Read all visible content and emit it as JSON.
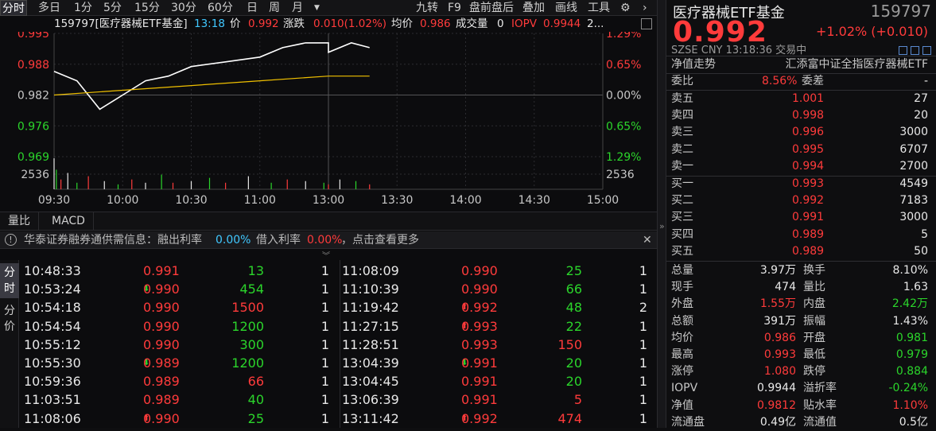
{
  "toolbar": {
    "left_items": [
      "分时",
      "多日",
      "1分",
      "5分",
      "15分",
      "30分",
      "60分",
      "日",
      "周",
      "月"
    ],
    "dropdown_glyph": "▼",
    "right_items": [
      "九转",
      "F9",
      "盘前盘后",
      "叠加",
      "画线",
      "工具"
    ]
  },
  "info": {
    "code_name": "159797[医疗器械ETF基金]",
    "time": "13:18",
    "price_label": "价",
    "price": "0.992",
    "change_label": "涨跌",
    "change": "0.010(1.02%)",
    "avg_label": "均价",
    "avg": "0.986",
    "volume_label": "成交量",
    "volume": "0",
    "iopv_label": "IOPV",
    "iopv": "0.9944",
    "more": "2..."
  },
  "chart": {
    "left_axis": [
      "0.995",
      "0.988",
      "0.982",
      "0.976",
      "0.969"
    ],
    "right_axis": [
      "1.29%",
      "0.65%",
      "0.00%",
      "0.65%",
      "1.29%"
    ],
    "vol_label_left": "2536",
    "vol_label_right": "2536",
    "time_axis": [
      "09:30",
      "10:00",
      "10:30",
      "11:00",
      "13:00",
      "13:30",
      "14:00",
      "14:30",
      "15:00"
    ]
  },
  "chart_data": {
    "type": "line",
    "series": [
      {
        "name": "价",
        "x": [
          "09:30",
          "09:40",
          "09:45",
          "09:50",
          "10:00",
          "10:10",
          "10:20",
          "10:30",
          "10:45",
          "11:00",
          "11:10",
          "11:20",
          "11:30",
          "13:00",
          "13:10",
          "13:18"
        ],
        "values": [
          0.987,
          0.985,
          0.982,
          0.979,
          0.982,
          0.985,
          0.986,
          0.988,
          0.989,
          0.99,
          0.992,
          0.993,
          0.993,
          0.991,
          0.993,
          0.992
        ]
      },
      {
        "name": "均价",
        "x": [
          "09:30",
          "10:00",
          "10:30",
          "11:00",
          "11:30",
          "13:18"
        ],
        "values": [
          0.982,
          0.983,
          0.984,
          0.985,
          0.986,
          0.986
        ]
      }
    ],
    "ylim": [
      0.969,
      0.995
    ]
  },
  "lower_tabs": [
    "量比",
    "MACD"
  ],
  "notice": {
    "source": "华泰证券融券通供需信息：融出利率",
    "lend_rate": "0.00%",
    "borrow_label": "借入利率",
    "borrow_rate": "0.00%",
    "more": "，点击查看更多"
  },
  "side_tabs": [
    "分时",
    "分价"
  ],
  "ticks": [
    {
      "time": "10:48:33",
      "price": "0.991",
      "dir": "",
      "vol": "13",
      "vc": "green",
      "n": "1"
    },
    {
      "time": "10:53:24",
      "price": "0.990",
      "dir": "down",
      "vol": "454",
      "vc": "green",
      "n": "1"
    },
    {
      "time": "10:54:18",
      "price": "0.990",
      "dir": "",
      "vol": "1500",
      "vc": "red",
      "n": "1"
    },
    {
      "time": "10:54:54",
      "price": "0.990",
      "dir": "",
      "vol": "1200",
      "vc": "green",
      "n": "1"
    },
    {
      "time": "10:55:12",
      "price": "0.990",
      "dir": "",
      "vol": "300",
      "vc": "green",
      "n": "1"
    },
    {
      "time": "10:55:30",
      "price": "0.989",
      "dir": "down",
      "vol": "1200",
      "vc": "green",
      "n": "1"
    },
    {
      "time": "10:59:36",
      "price": "0.989",
      "dir": "",
      "vol": "66",
      "vc": "red",
      "n": "1"
    },
    {
      "time": "11:03:51",
      "price": "0.989",
      "dir": "",
      "vol": "40",
      "vc": "green",
      "n": "1"
    },
    {
      "time": "11:08:06",
      "price": "0.990",
      "dir": "up",
      "vol": "25",
      "vc": "green",
      "n": "1"
    },
    {
      "time": "11:08:09",
      "price": "0.990",
      "dir": "",
      "vol": "25",
      "vc": "green",
      "n": "1"
    },
    {
      "time": "11:10:39",
      "price": "0.990",
      "dir": "",
      "vol": "66",
      "vc": "green",
      "n": "1"
    },
    {
      "time": "11:19:42",
      "price": "0.992",
      "dir": "up",
      "vol": "48",
      "vc": "green",
      "n": "2"
    },
    {
      "time": "11:27:15",
      "price": "0.993",
      "dir": "up",
      "vol": "22",
      "vc": "green",
      "n": "1"
    },
    {
      "time": "11:28:51",
      "price": "0.993",
      "dir": "",
      "vol": "150",
      "vc": "red",
      "n": "1"
    },
    {
      "time": "13:04:39",
      "price": "0.991",
      "dir": "down",
      "vol": "20",
      "vc": "green",
      "n": "1"
    },
    {
      "time": "13:04:45",
      "price": "0.991",
      "dir": "",
      "vol": "20",
      "vc": "green",
      "n": "1"
    },
    {
      "time": "13:06:39",
      "price": "0.991",
      "dir": "",
      "vol": "5",
      "vc": "red",
      "n": "1"
    },
    {
      "time": "13:11:42",
      "price": "0.992",
      "dir": "up",
      "vol": "474",
      "vc": "red",
      "n": "1"
    }
  ],
  "quote": {
    "name": "医疗器械ETF基金",
    "code": "159797",
    "price": "0.992",
    "change": "+1.02% (+0.010)",
    "meta": "SZSE  CNY  13:18:36  交易中",
    "nav_label": "净值走势",
    "fund_full": "汇添富中证全指医疗器械ETF",
    "weibi_label": "委比",
    "weibi": "8.56%",
    "weicha_label": "委差",
    "weicha": "-",
    "asks": [
      {
        "label": "卖五",
        "price": "1.001",
        "vol": "27"
      },
      {
        "label": "卖四",
        "price": "0.998",
        "vol": "20"
      },
      {
        "label": "卖三",
        "price": "0.996",
        "vol": "3000"
      },
      {
        "label": "卖二",
        "price": "0.995",
        "vol": "6707"
      },
      {
        "label": "卖一",
        "price": "0.994",
        "vol": "2700"
      }
    ],
    "bids": [
      {
        "label": "买一",
        "price": "0.993",
        "vol": "4549"
      },
      {
        "label": "买二",
        "price": "0.992",
        "vol": "7183"
      },
      {
        "label": "买三",
        "price": "0.991",
        "vol": "3000"
      },
      {
        "label": "买四",
        "price": "0.989",
        "vol": "5"
      },
      {
        "label": "买五",
        "price": "0.989",
        "vol": "50"
      }
    ],
    "stats": [
      {
        "l1": "总量",
        "v1": "3.97万",
        "c1": "white",
        "l2": "换手",
        "v2": "8.10%",
        "c2": "white"
      },
      {
        "l1": "现手",
        "v1": "474",
        "c1": "white",
        "l2": "量比",
        "v2": "1.63",
        "c2": "white"
      },
      {
        "l1": "外盘",
        "v1": "1.55万",
        "c1": "red",
        "l2": "内盘",
        "v2": "2.42万",
        "c2": "green"
      },
      {
        "l1": "总额",
        "v1": "391万",
        "c1": "white",
        "l2": "振幅",
        "v2": "1.43%",
        "c2": "white"
      },
      {
        "l1": "均价",
        "v1": "0.986",
        "c1": "red",
        "l2": "开盘",
        "v2": "0.981",
        "c2": "green"
      },
      {
        "l1": "最高",
        "v1": "0.993",
        "c1": "red",
        "l2": "最低",
        "v2": "0.979",
        "c2": "green"
      },
      {
        "l1": "涨停",
        "v1": "1.080",
        "c1": "red",
        "l2": "跌停",
        "v2": "0.884",
        "c2": "green"
      },
      {
        "l1": "IOPV",
        "v1": "0.9944",
        "c1": "white",
        "l2": "溢折率",
        "v2": "-0.24%",
        "c2": "green"
      },
      {
        "l1": "净值",
        "v1": "0.9812",
        "c1": "red",
        "l2": "贴水率",
        "v2": "1.10%",
        "c2": "red"
      },
      {
        "l1": "流通盘",
        "v1": "0.49亿",
        "c1": "white",
        "l2": "流通值",
        "v2": "0.5亿",
        "c2": "white"
      }
    ]
  },
  "colors": {
    "up": "#ff3b3b",
    "down": "#2bd52b",
    "price_line": "#ffffff",
    "avg_line": "#f0c000"
  }
}
